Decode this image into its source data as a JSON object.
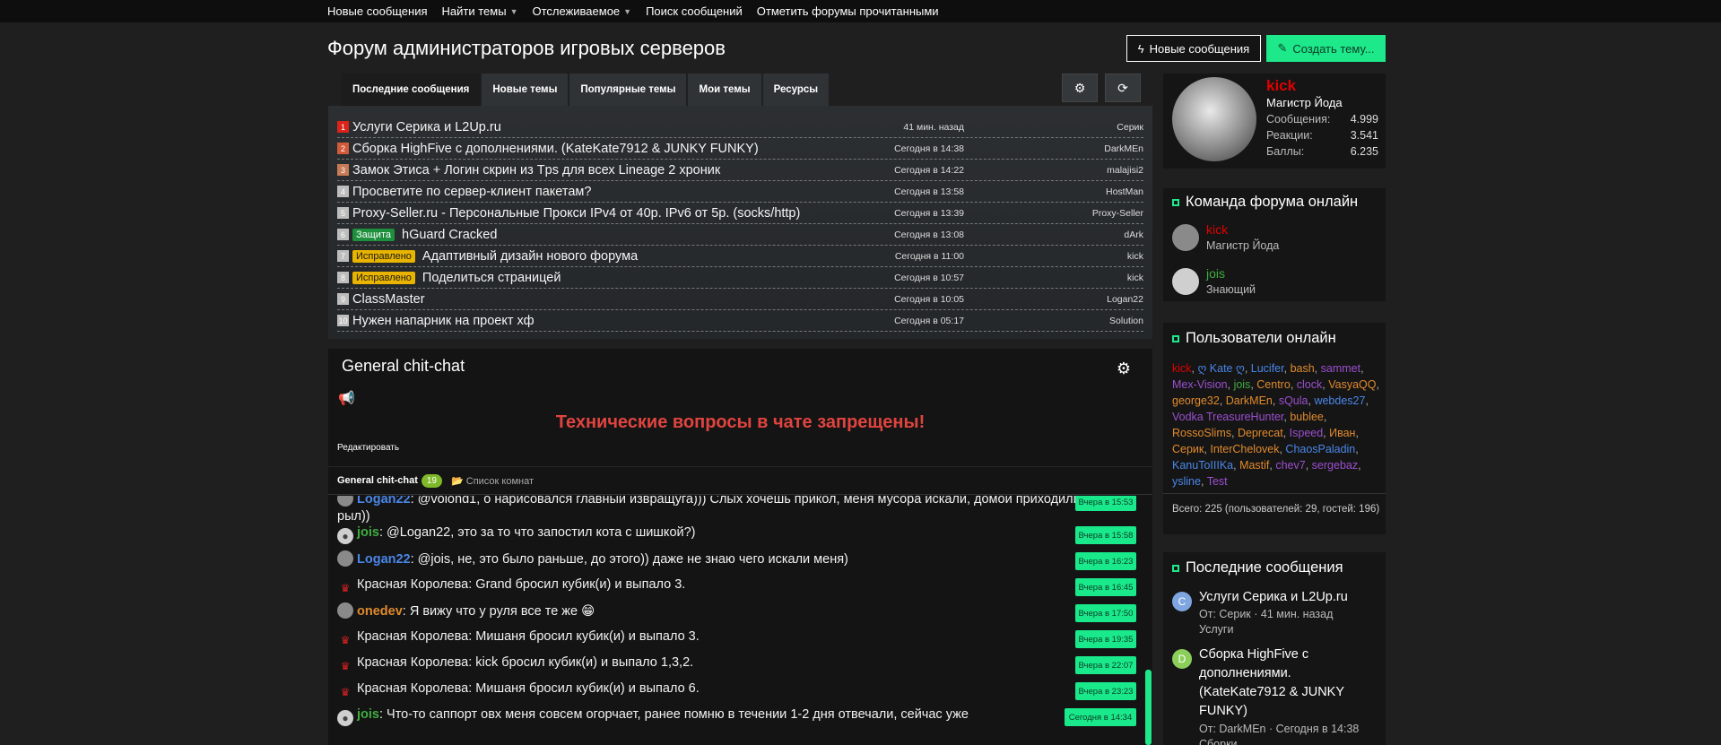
{
  "topnav": [
    {
      "label": "Новые сообщения",
      "dropdown": false
    },
    {
      "label": "Найти темы",
      "dropdown": true
    },
    {
      "label": "Отслеживаемое",
      "dropdown": true
    },
    {
      "label": "Поиск сообщений",
      "dropdown": false
    },
    {
      "label": "Отметить форумы прочитанными",
      "dropdown": false
    }
  ],
  "forum_title": "Форум администраторов игровых серверов",
  "buttons": {
    "new_messages": "Новые сообщения",
    "create_topic": "Создать тему..."
  },
  "tabs": [
    "Последние сообщения",
    "Новые темы",
    "Популярные темы",
    "Мои темы",
    "Ресурсы"
  ],
  "topics": [
    {
      "rank": "1",
      "rank_color": "#d9241c",
      "prefix": "",
      "prefix_style": "",
      "title": "Услуги Серика и L2Up.ru",
      "time": "41 мин. назад",
      "user": "Серик"
    },
    {
      "rank": "2",
      "rank_color": "#d25a3a",
      "prefix": "",
      "prefix_style": "",
      "title": "Сборка HighFive с дополнениями. (KateKate7912 & JUNKY FUNKY)",
      "time": "Сегодня в 14:38",
      "user": "DarkMEn"
    },
    {
      "rank": "3",
      "rank_color": "#c77a55",
      "prefix": "",
      "prefix_style": "",
      "title": "Замок Этиса + Логин скрин из Tps для всех Lineage 2 хроник",
      "time": "Сегодня в 14:22",
      "user": "malajisi2"
    },
    {
      "rank": "4",
      "rank_color": "#bdbdbd",
      "prefix": "",
      "prefix_style": "",
      "title": "Просветите по сервер-клиент пакетам?",
      "time": "Сегодня в 13:58",
      "user": "HostMan"
    },
    {
      "rank": "5",
      "rank_color": "#bdbdbd",
      "prefix": "",
      "prefix_style": "",
      "title": "Proxy-Seller.ru - Персональные Прокси IPv4 от 40р. IPv6 от 5р. (socks/http)",
      "time": "Сегодня в 13:39",
      "user": "Proxy-Seller"
    },
    {
      "rank": "6",
      "rank_color": "#bdbdbd",
      "prefix": "Защита",
      "prefix_style": "green",
      "title": "hGuard Cracked",
      "time": "Сегодня в 13:08",
      "user": "dArk"
    },
    {
      "rank": "7",
      "rank_color": "#bdbdbd",
      "prefix": "Исправлено",
      "prefix_style": "yellow",
      "title": "Адаптивный дизайн нового форума",
      "time": "Сегодня в 11:00",
      "user": "kick"
    },
    {
      "rank": "8",
      "rank_color": "#bdbdbd",
      "prefix": "Исправлено",
      "prefix_style": "yellow",
      "title": "Поделиться страницей",
      "time": "Сегодня в 10:57",
      "user": "kick"
    },
    {
      "rank": "9",
      "rank_color": "#bdbdbd",
      "prefix": "",
      "prefix_style": "",
      "title": "ClassMaster",
      "time": "Сегодня в 10:05",
      "user": "Logan22"
    },
    {
      "rank": "10",
      "rank_color": "#bdbdbd",
      "prefix": "",
      "prefix_style": "",
      "title": "Нужен напарник на проект хф",
      "time": "Сегодня в 05:17",
      "user": "Solution"
    }
  ],
  "chat": {
    "title": "General chit-chat",
    "notice": "Технические вопросы в чате запрещены!",
    "edit": "Редактировать",
    "room": "General chit-chat",
    "room_count": "19",
    "room_list": "Список комнат",
    "messages": [
      {
        "avatar": "photo",
        "user": "Logan22",
        "user_color": "blue",
        "text": ": @volond1, о нарисовался главный извращуга))) Слых хочешь прикол, меня мусора искали, домой приходили в 5 рыл))",
        "time": "Вчера в 15:53"
      },
      {
        "avatar": "user",
        "user": "jois",
        "user_color": "green",
        "text": ": @Logan22, это за то что запостил кота с шишкой?)",
        "time": "Вчера в 15:58"
      },
      {
        "avatar": "photo",
        "user": "Logan22",
        "user_color": "blue",
        "text": ": @jois, не, это было раньше, до этого)) даже не знаю чего искали меня)",
        "time": "Вчера в 16:23"
      },
      {
        "avatar": "queen",
        "user": "",
        "user_color": "",
        "text": "Красная Королева: Grand бросил кубик(и) и выпало 3.",
        "time": "Вчера в 16:45"
      },
      {
        "avatar": "photo",
        "user": "onedev",
        "user_color": "orange",
        "text": ": Я вижу что у руля все те же 😁",
        "time": "Вчера в 17:50"
      },
      {
        "avatar": "queen",
        "user": "",
        "user_color": "",
        "text": "Красная Королева: Мишаня бросил кубик(и) и выпало 3.",
        "time": "Вчера в 19:35"
      },
      {
        "avatar": "queen",
        "user": "",
        "user_color": "",
        "text": "Красная Королева: kick бросил кубик(и) и выпало 1,3,2.",
        "time": "Вчера в 22:07"
      },
      {
        "avatar": "queen",
        "user": "",
        "user_color": "",
        "text": "Красная Королева: Мишаня бросил кубик(и) и выпало 6.",
        "time": "Вчера в 23:23"
      },
      {
        "avatar": "user",
        "user": "jois",
        "user_color": "green",
        "text": ": Что-то саппорт овх меня совсем огорчает, ранее помню в течении 1-2 дня отвечали, сейчас уже",
        "time": "Сегодня в 14:34"
      }
    ]
  },
  "profile": {
    "name": "kick",
    "title": "Магистр Йода",
    "stats": [
      {
        "label": "Сообщения:",
        "value": "4.999"
      },
      {
        "label": "Реакции:",
        "value": "3.541"
      },
      {
        "label": "Баллы:",
        "value": "6.235"
      }
    ]
  },
  "staff": {
    "title": "Команда форума онлайн",
    "members": [
      {
        "name": "kick",
        "role": "Магистр Йода",
        "color": "#e00000"
      },
      {
        "name": "jois",
        "role": "Знающий",
        "color": "#3fae3f"
      }
    ]
  },
  "online": {
    "title": "Пользователи онлайн",
    "users": [
      {
        "name": "kick",
        "color": "#e00000"
      },
      {
        "name": "ღ Kate ღ",
        "color": "#4a86e8"
      },
      {
        "name": "Lucifer",
        "color": "#4a86e8"
      },
      {
        "name": "bash",
        "color": "#e08a2e"
      },
      {
        "name": "sammet",
        "color": "#9b4fcf"
      },
      {
        "name": "Mex-Vision",
        "color": "#9b4fcf"
      },
      {
        "name": "jois",
        "color": "#3fae3f"
      },
      {
        "name": "Centro",
        "color": "#e08a2e"
      },
      {
        "name": "clock",
        "color": "#9b4fcf"
      },
      {
        "name": "VasyaQQ",
        "color": "#e08a2e"
      },
      {
        "name": "george32",
        "color": "#e08a2e"
      },
      {
        "name": "DarkMEn",
        "color": "#e08a2e"
      },
      {
        "name": "sQula",
        "color": "#9b4fcf"
      },
      {
        "name": "webdes27",
        "color": "#4a86e8"
      },
      {
        "name": "Vodka TreasureHunter",
        "color": "#9b4fcf"
      },
      {
        "name": "bublee",
        "color": "#e08a2e"
      },
      {
        "name": "RossoSlims",
        "color": "#e08a2e"
      },
      {
        "name": "Deprecat",
        "color": "#e08a2e"
      },
      {
        "name": "Ispeed",
        "color": "#9b4fcf"
      },
      {
        "name": "Иван",
        "color": "#e08a2e"
      },
      {
        "name": "Серик",
        "color": "#e08a2e"
      },
      {
        "name": "InterChelovek",
        "color": "#e08a2e"
      },
      {
        "name": "ChaosPaladin",
        "color": "#4a86e8"
      },
      {
        "name": "KanuToIIIKa",
        "color": "#4a86e8"
      },
      {
        "name": "Mastif",
        "color": "#e08a2e"
      },
      {
        "name": "chev7",
        "color": "#9b4fcf"
      },
      {
        "name": "sergebaz",
        "color": "#9b4fcf"
      },
      {
        "name": "ysline",
        "color": "#4a86e8"
      },
      {
        "name": "Test",
        "color": "#9b4fcf"
      }
    ],
    "total": "Всего: 225 (пользователей: 29, гостей: 196)"
  },
  "latest": {
    "title": "Последние сообщения",
    "items": [
      {
        "letter": "С",
        "color": "#7fa6e0",
        "title": "Услуги Серика и L2Up.ru",
        "meta1": "От: Серик · 41 мин. назад",
        "meta2": "Услуги"
      },
      {
        "letter": "D",
        "color": "#8bcf5a",
        "title": "Сборка HighFive с дополнениями. (KateKate7912 & JUNKY FUNKY)",
        "meta1": "От: DarkMEn · Сегодня в 14:38",
        "meta2": "Сборки"
      }
    ]
  }
}
